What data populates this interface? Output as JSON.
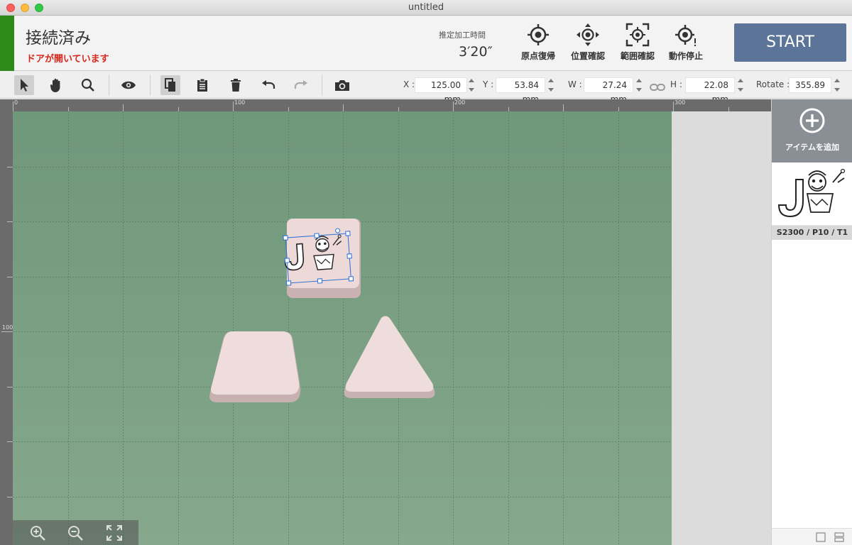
{
  "window": {
    "title": "untitled"
  },
  "header": {
    "status": "接続済み",
    "status_sub": "ドアが開いています",
    "estimate_label": "推定加工時間",
    "estimate_value": "3′20″",
    "buttons": [
      {
        "label": "原点復帰",
        "icon": "home-target-icon"
      },
      {
        "label": "位置確認",
        "icon": "move-target-icon"
      },
      {
        "label": "範囲確認",
        "icon": "frame-target-icon"
      },
      {
        "label": "動作停止",
        "icon": "stop-target-icon"
      }
    ],
    "start_label": "START",
    "accent": "#5b7498",
    "status_color": "#2f8a1c",
    "warning_color": "#d9261c"
  },
  "toolbar": {
    "fields": {
      "x_label": "X :",
      "x_value": "125.00 mm",
      "y_label": "Y :",
      "y_value": "53.84 mm",
      "w_label": "W :",
      "w_value": "27.24 mm",
      "h_label": "H :",
      "h_value": "22.08 mm",
      "rotate_label": "Rotate :",
      "rotate_value": "355.89"
    }
  },
  "ruler": {
    "top_labels": [
      "0",
      "100",
      "200",
      "300"
    ],
    "left_labels": [
      "100"
    ]
  },
  "side": {
    "add_label": "アイテムを追加",
    "item_label": "S2300 / P10 / T1"
  }
}
